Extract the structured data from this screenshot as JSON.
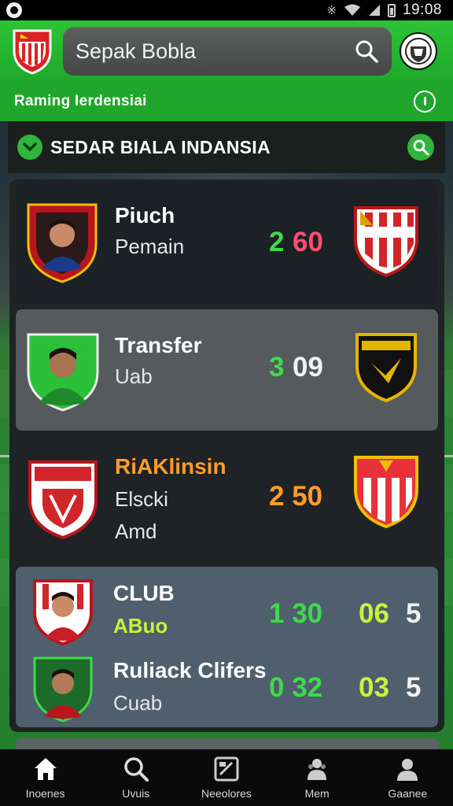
{
  "status_bar": {
    "time": "19:08",
    "icons": [
      "bluetooth-icon",
      "wifi-icon",
      "signal-icon",
      "battery-icon"
    ]
  },
  "app_bar": {
    "search_title": "Sepak Bobla",
    "search_icon": "search-icon"
  },
  "sub_bar": {
    "text": "Raming Ierdensiai"
  },
  "section": {
    "title": "SEDAR BIALA INDANSIA"
  },
  "cards": [
    {
      "title": "Piuch",
      "subtitle": "Pemain",
      "score_a": "2",
      "score_b": "60"
    },
    {
      "title": "Transfer",
      "subtitle": "Uab",
      "score_a": "3",
      "score_b": "09"
    },
    {
      "title": "RiAKlinsin",
      "subtitle": "Elscki",
      "subtitle2": "Amd",
      "score": "2 50"
    },
    {
      "rows": [
        {
          "title": "CLUB",
          "subtitle": "ABuo",
          "score_a": "1 30",
          "score_b": "06",
          "score_c": "5"
        },
        {
          "title": "Ruliack Clifers",
          "subtitle": "Cuab",
          "score_a": "0 32",
          "score_b": "03",
          "score_c": "5"
        }
      ]
    }
  ],
  "bottom_nav": [
    {
      "label": "Inoenes",
      "icon": "home-icon"
    },
    {
      "label": "Uvuis",
      "icon": "search-icon"
    },
    {
      "label": "Neeolores",
      "icon": "news-icon"
    },
    {
      "label": "Mem",
      "icon": "teams-icon"
    },
    {
      "label": "Gaanee",
      "icon": "profile-icon"
    }
  ],
  "colors": {
    "brand_green": "#1ea82a",
    "score_green": "#3fd94c",
    "score_pink": "#ff4d6d",
    "score_orange": "#ff9c2a",
    "score_lime": "#c9f23a"
  }
}
